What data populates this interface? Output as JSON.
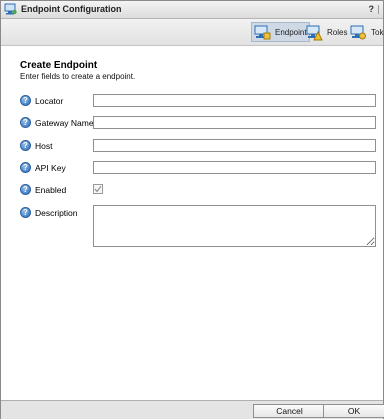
{
  "window": {
    "title": "Endpoint Configuration",
    "help_label": "?"
  },
  "toolbar": {
    "buttons": [
      {
        "label": "Endpoint",
        "icon": "endpoint-icon",
        "active": true
      },
      {
        "label": "Roles",
        "icon": "roles-icon",
        "active": false
      },
      {
        "label": "Toke",
        "icon": "tokens-icon",
        "active": false
      }
    ]
  },
  "form": {
    "heading": "Create Endpoint",
    "subheading": "Enter fields to create a endpoint.",
    "fields": [
      {
        "label": "Locator",
        "value": ""
      },
      {
        "label": "Gateway Name",
        "value": ""
      },
      {
        "label": "Host",
        "value": ""
      },
      {
        "label": "API Key",
        "value": ""
      },
      {
        "label": "Enabled",
        "checked": true
      },
      {
        "label": "Description",
        "value": ""
      }
    ]
  },
  "footer": {
    "cancel_label": "Cancel",
    "ok_label": "OK"
  },
  "colors": {
    "accent": "#2f6fba",
    "active_tab": "#cfd9e6"
  }
}
